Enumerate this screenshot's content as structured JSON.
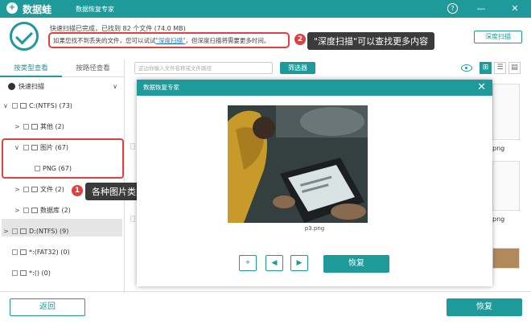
{
  "titlebar": {
    "brand": "数据蛙",
    "title": "数据恢复专家",
    "help": "?",
    "minimize": "—",
    "close": "✕"
  },
  "status": {
    "summary": "快速扫描已完成，已找到 82 个文件 (74.0 MB)",
    "hint_prefix": "如果您找不到丢失的文件，您可以试试",
    "hint_link": "\"深度扫描\"",
    "hint_suffix": "，但深度扫描将需要更多时间。",
    "deep_scan_button": "深度扫描"
  },
  "annotations": [
    {
      "number": "2",
      "text": "\"深度扫描\"可以查找更多内容"
    },
    {
      "number": "1",
      "text": "各种图片类型在这里可查看"
    }
  ],
  "left_panel": {
    "tabs": [
      "按类型查看",
      "按路径查看"
    ],
    "quick_scan": "快速扫描",
    "tree": [
      {
        "label": "C:(NTFS) (73)",
        "arrow": "∨"
      },
      {
        "label": "其他 (2)",
        "arrow": ">"
      },
      {
        "label": "图片 (67)",
        "arrow": "∨"
      },
      {
        "label": "PNG (67)",
        "arrow": ""
      },
      {
        "label": "文件 (2)",
        "arrow": ">"
      },
      {
        "label": "数据库 (2)",
        "arrow": ">"
      },
      {
        "label": "D:(NTFS) (9)",
        "arrow": ">"
      },
      {
        "label": "*:(FAT32) (0)",
        "arrow": ""
      },
      {
        "label": "*:() (0)",
        "arrow": ""
      }
    ]
  },
  "toolbar": {
    "search_placeholder": "这边你输入文件名称或文件路径",
    "filter_button": "筛选器",
    "view_icons": [
      "⊞",
      "☰",
      "▤"
    ]
  },
  "background_labels": [
    "png",
    "png"
  ],
  "dialog": {
    "title": "数据恢复专家",
    "caption": "p3.png",
    "controls": [
      "⌖",
      "◀",
      "▶"
    ],
    "recover_button": "恢复"
  },
  "footer": {
    "back_button": "返回",
    "recover_button": "恢复"
  },
  "colors": {
    "accent": "#1e9a9a",
    "highlight": "#e04040",
    "callout_bg": "#3b3b3b"
  }
}
